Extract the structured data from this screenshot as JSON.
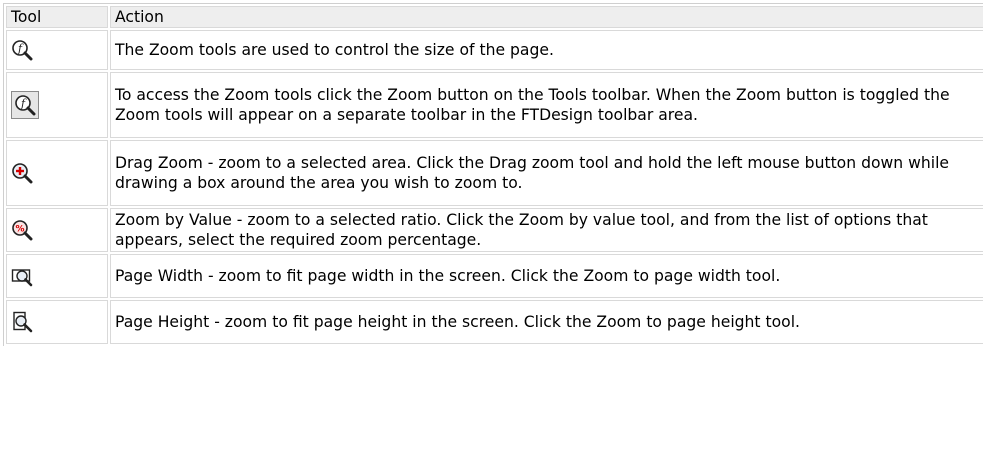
{
  "table": {
    "headers": {
      "tool": "Tool",
      "action": "Action"
    },
    "rows": [
      {
        "icon": "zoom-tools-icon",
        "action": "The Zoom tools are used to control the size of the page."
      },
      {
        "icon": "zoom-button-toggled-icon",
        "action": "To access the Zoom tools click the Zoom button on the Tools toolbar. When the Zoom button is toggled the Zoom tools will appear on a separate toolbar in the FTDesign toolbar area."
      },
      {
        "icon": "drag-zoom-icon",
        "action": "Drag Zoom - zoom to a selected area. Click the Drag zoom tool and hold the left mouse button down while drawing a box around the area you wish to zoom to."
      },
      {
        "icon": "zoom-by-value-icon",
        "action": "Zoom by Value - zoom to a selected ratio. Click the Zoom by value tool, and from the list of options that appears, select the required zoom percentage."
      },
      {
        "icon": "page-width-icon",
        "action": "Page Width - zoom to fit page width in the screen. Click the Zoom to page width tool."
      },
      {
        "icon": "page-height-icon",
        "action": "Page Height - zoom to fit page height in the screen. Click the Zoom to page height tool."
      }
    ]
  },
  "colors": {
    "header_bg": "#eeeeee",
    "border": "#d9d9d9",
    "text": "#000000",
    "lens_red": "#d40000",
    "lens_glass": "#e8eef5"
  }
}
